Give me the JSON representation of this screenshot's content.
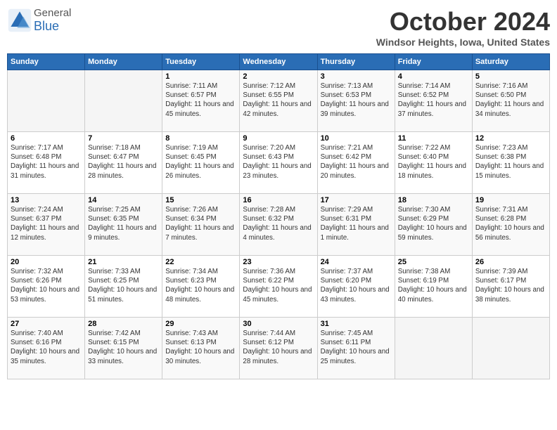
{
  "header": {
    "logo_general": "General",
    "logo_blue": "Blue",
    "main_title": "October 2024",
    "subtitle": "Windsor Heights, Iowa, United States"
  },
  "days_of_week": [
    "Sunday",
    "Monday",
    "Tuesday",
    "Wednesday",
    "Thursday",
    "Friday",
    "Saturday"
  ],
  "weeks": [
    [
      {
        "day": "",
        "sunrise": "",
        "sunset": "",
        "daylight": "",
        "empty": true
      },
      {
        "day": "",
        "sunrise": "",
        "sunset": "",
        "daylight": "",
        "empty": true
      },
      {
        "day": "1",
        "sunrise": "Sunrise: 7:11 AM",
        "sunset": "Sunset: 6:57 PM",
        "daylight": "Daylight: 11 hours and 45 minutes."
      },
      {
        "day": "2",
        "sunrise": "Sunrise: 7:12 AM",
        "sunset": "Sunset: 6:55 PM",
        "daylight": "Daylight: 11 hours and 42 minutes."
      },
      {
        "day": "3",
        "sunrise": "Sunrise: 7:13 AM",
        "sunset": "Sunset: 6:53 PM",
        "daylight": "Daylight: 11 hours and 39 minutes."
      },
      {
        "day": "4",
        "sunrise": "Sunrise: 7:14 AM",
        "sunset": "Sunset: 6:52 PM",
        "daylight": "Daylight: 11 hours and 37 minutes."
      },
      {
        "day": "5",
        "sunrise": "Sunrise: 7:16 AM",
        "sunset": "Sunset: 6:50 PM",
        "daylight": "Daylight: 11 hours and 34 minutes."
      }
    ],
    [
      {
        "day": "6",
        "sunrise": "Sunrise: 7:17 AM",
        "sunset": "Sunset: 6:48 PM",
        "daylight": "Daylight: 11 hours and 31 minutes."
      },
      {
        "day": "7",
        "sunrise": "Sunrise: 7:18 AM",
        "sunset": "Sunset: 6:47 PM",
        "daylight": "Daylight: 11 hours and 28 minutes."
      },
      {
        "day": "8",
        "sunrise": "Sunrise: 7:19 AM",
        "sunset": "Sunset: 6:45 PM",
        "daylight": "Daylight: 11 hours and 26 minutes."
      },
      {
        "day": "9",
        "sunrise": "Sunrise: 7:20 AM",
        "sunset": "Sunset: 6:43 PM",
        "daylight": "Daylight: 11 hours and 23 minutes."
      },
      {
        "day": "10",
        "sunrise": "Sunrise: 7:21 AM",
        "sunset": "Sunset: 6:42 PM",
        "daylight": "Daylight: 11 hours and 20 minutes."
      },
      {
        "day": "11",
        "sunrise": "Sunrise: 7:22 AM",
        "sunset": "Sunset: 6:40 PM",
        "daylight": "Daylight: 11 hours and 18 minutes."
      },
      {
        "day": "12",
        "sunrise": "Sunrise: 7:23 AM",
        "sunset": "Sunset: 6:38 PM",
        "daylight": "Daylight: 11 hours and 15 minutes."
      }
    ],
    [
      {
        "day": "13",
        "sunrise": "Sunrise: 7:24 AM",
        "sunset": "Sunset: 6:37 PM",
        "daylight": "Daylight: 11 hours and 12 minutes."
      },
      {
        "day": "14",
        "sunrise": "Sunrise: 7:25 AM",
        "sunset": "Sunset: 6:35 PM",
        "daylight": "Daylight: 11 hours and 9 minutes."
      },
      {
        "day": "15",
        "sunrise": "Sunrise: 7:26 AM",
        "sunset": "Sunset: 6:34 PM",
        "daylight": "Daylight: 11 hours and 7 minutes."
      },
      {
        "day": "16",
        "sunrise": "Sunrise: 7:28 AM",
        "sunset": "Sunset: 6:32 PM",
        "daylight": "Daylight: 11 hours and 4 minutes."
      },
      {
        "day": "17",
        "sunrise": "Sunrise: 7:29 AM",
        "sunset": "Sunset: 6:31 PM",
        "daylight": "Daylight: 11 hours and 1 minute."
      },
      {
        "day": "18",
        "sunrise": "Sunrise: 7:30 AM",
        "sunset": "Sunset: 6:29 PM",
        "daylight": "Daylight: 10 hours and 59 minutes."
      },
      {
        "day": "19",
        "sunrise": "Sunrise: 7:31 AM",
        "sunset": "Sunset: 6:28 PM",
        "daylight": "Daylight: 10 hours and 56 minutes."
      }
    ],
    [
      {
        "day": "20",
        "sunrise": "Sunrise: 7:32 AM",
        "sunset": "Sunset: 6:26 PM",
        "daylight": "Daylight: 10 hours and 53 minutes."
      },
      {
        "day": "21",
        "sunrise": "Sunrise: 7:33 AM",
        "sunset": "Sunset: 6:25 PM",
        "daylight": "Daylight: 10 hours and 51 minutes."
      },
      {
        "day": "22",
        "sunrise": "Sunrise: 7:34 AM",
        "sunset": "Sunset: 6:23 PM",
        "daylight": "Daylight: 10 hours and 48 minutes."
      },
      {
        "day": "23",
        "sunrise": "Sunrise: 7:36 AM",
        "sunset": "Sunset: 6:22 PM",
        "daylight": "Daylight: 10 hours and 45 minutes."
      },
      {
        "day": "24",
        "sunrise": "Sunrise: 7:37 AM",
        "sunset": "Sunset: 6:20 PM",
        "daylight": "Daylight: 10 hours and 43 minutes."
      },
      {
        "day": "25",
        "sunrise": "Sunrise: 7:38 AM",
        "sunset": "Sunset: 6:19 PM",
        "daylight": "Daylight: 10 hours and 40 minutes."
      },
      {
        "day": "26",
        "sunrise": "Sunrise: 7:39 AM",
        "sunset": "Sunset: 6:17 PM",
        "daylight": "Daylight: 10 hours and 38 minutes."
      }
    ],
    [
      {
        "day": "27",
        "sunrise": "Sunrise: 7:40 AM",
        "sunset": "Sunset: 6:16 PM",
        "daylight": "Daylight: 10 hours and 35 minutes."
      },
      {
        "day": "28",
        "sunrise": "Sunrise: 7:42 AM",
        "sunset": "Sunset: 6:15 PM",
        "daylight": "Daylight: 10 hours and 33 minutes."
      },
      {
        "day": "29",
        "sunrise": "Sunrise: 7:43 AM",
        "sunset": "Sunset: 6:13 PM",
        "daylight": "Daylight: 10 hours and 30 minutes."
      },
      {
        "day": "30",
        "sunrise": "Sunrise: 7:44 AM",
        "sunset": "Sunset: 6:12 PM",
        "daylight": "Daylight: 10 hours and 28 minutes."
      },
      {
        "day": "31",
        "sunrise": "Sunrise: 7:45 AM",
        "sunset": "Sunset: 6:11 PM",
        "daylight": "Daylight: 10 hours and 25 minutes."
      },
      {
        "day": "",
        "sunrise": "",
        "sunset": "",
        "daylight": "",
        "empty": true
      },
      {
        "day": "",
        "sunrise": "",
        "sunset": "",
        "daylight": "",
        "empty": true
      }
    ]
  ]
}
